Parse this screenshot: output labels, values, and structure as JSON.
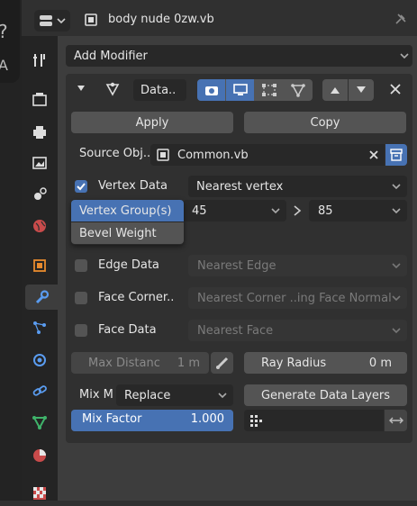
{
  "header": {
    "title": "body nude 0zw.vb"
  },
  "modifier_panel": {
    "add_modifier_label": "Add Modifier",
    "name": "Data..",
    "apply_label": "Apply",
    "copy_label": "Copy",
    "source_object_label": "Source Obj..",
    "source_object_value": "Common.vb",
    "vertex_data": {
      "label": "Vertex Data",
      "checked": true,
      "mapping": "Nearest vertex",
      "source_layer": "45",
      "destination_layer": "85"
    },
    "vertex_data_type_menu": {
      "options": [
        "Vertex Group(s)",
        "Bevel Weight"
      ],
      "selected": "Vertex Group(s)"
    },
    "edge_data": {
      "label": "Edge Data",
      "checked": false,
      "mapping": "Nearest Edge"
    },
    "face_corner_data": {
      "label": "Face Corner..",
      "checked": false,
      "mapping": "Nearest Corner ..ing Face Normal"
    },
    "face_data": {
      "label": "Face Data",
      "checked": false,
      "mapping": "Nearest Face"
    },
    "max_distance": {
      "label": "Max Distanc",
      "value": "1 m"
    },
    "ray_radius": {
      "label": "Ray Radius",
      "value": "0 m"
    },
    "mix_mode": {
      "label": "Mix M",
      "value": "Replace"
    },
    "generate_data_layers_label": "Generate Data Layers",
    "mix_factor": {
      "label": "Mix Factor",
      "value": "1.000",
      "fraction": 1.0
    }
  },
  "colors": {
    "accent": "#4772b3",
    "panel": "#3d3d3d",
    "background": "#303030",
    "field": "#282828"
  }
}
